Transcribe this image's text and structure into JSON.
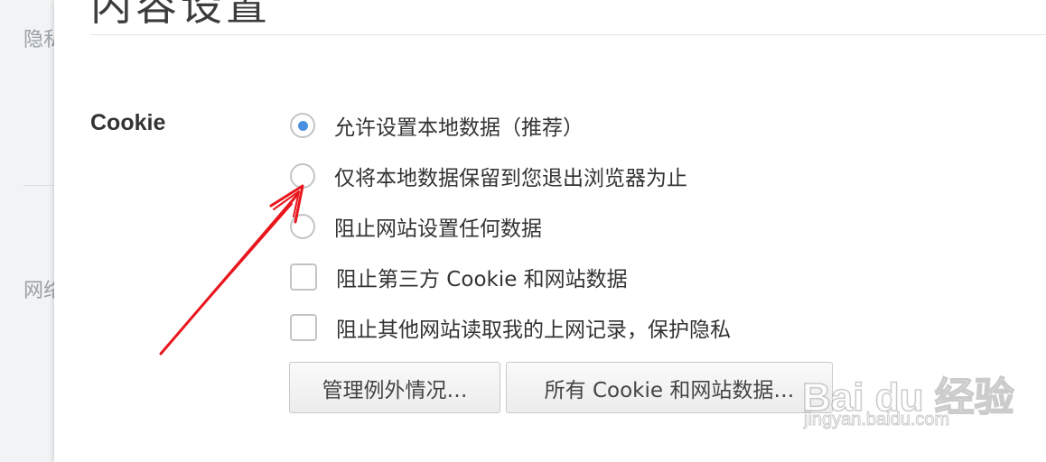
{
  "sidebar": {
    "item_1": "隐私",
    "item_2": "网络"
  },
  "dialog": {
    "title": "内容设置"
  },
  "cookie_section": {
    "label": "Cookie",
    "options": [
      {
        "type": "radio",
        "label": "允许设置本地数据（推荐）",
        "checked": true
      },
      {
        "type": "radio",
        "label": "仅将本地数据保留到您退出浏览器为止",
        "checked": false
      },
      {
        "type": "radio",
        "label": "阻止网站设置任何数据",
        "checked": false
      },
      {
        "type": "checkbox",
        "label": "阻止第三方 Cookie 和网站数据",
        "checked": false
      },
      {
        "type": "checkbox",
        "label": "阻止其他网站读取我的上网记录，保护隐私",
        "checked": false
      }
    ],
    "buttons": {
      "manage_exceptions": "管理例外情况…",
      "all_cookies": "所有 Cookie 和网站数据…"
    }
  },
  "annotation": {
    "arrow_color": "#e8161d"
  },
  "watermark": {
    "logo": "Bai du 经验",
    "url": "jingyan.baidu.com"
  }
}
